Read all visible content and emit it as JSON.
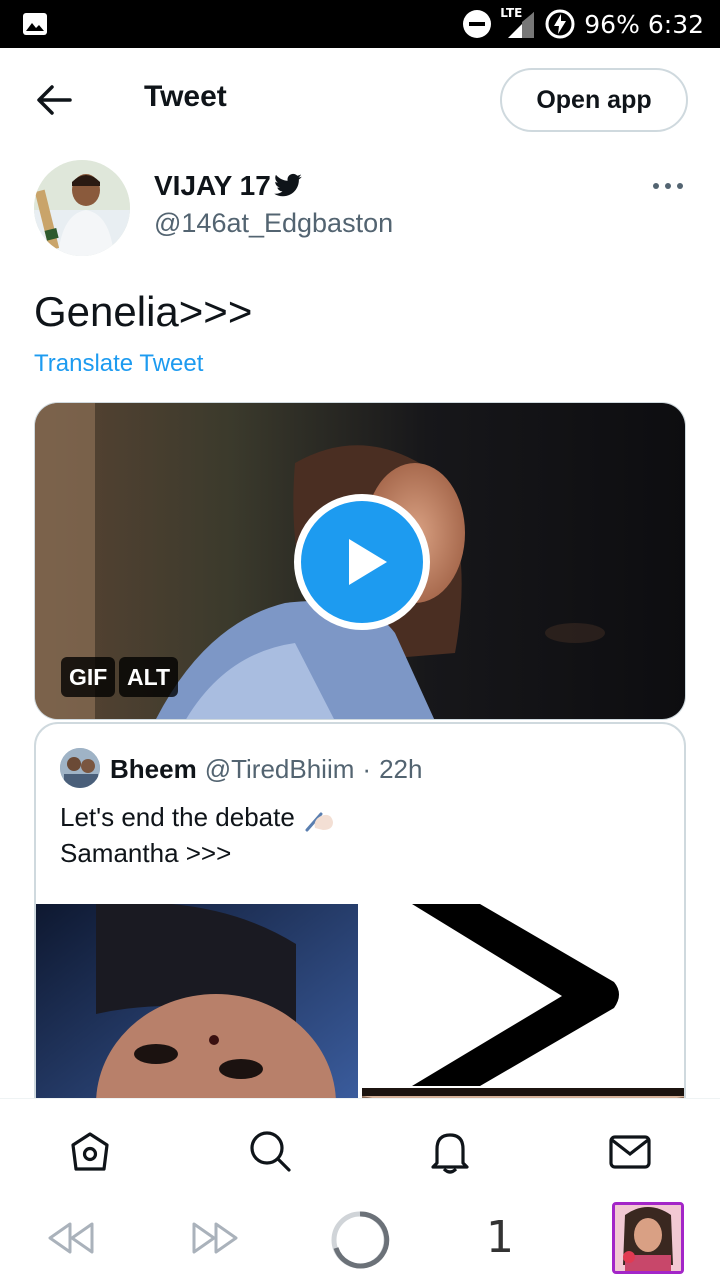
{
  "status_bar": {
    "network": "LTE",
    "battery": "96%",
    "time": "6:32"
  },
  "header": {
    "title": "Tweet",
    "open_app_label": "Open app"
  },
  "tweet": {
    "author_name": "VIJAY 17",
    "author_handle": "@146at_Edgbaston",
    "text": "Genelia>>>",
    "translate_label": "Translate Tweet",
    "media": {
      "gif_badge": "GIF",
      "alt_badge": "ALT"
    }
  },
  "quoted_tweet": {
    "name": "Bheem",
    "handle": "@TiredBhiim",
    "separator": "·",
    "time": "22h",
    "line1": "Let's end the debate",
    "line2": "Samantha >>>"
  },
  "bottom_nav": {
    "items": [
      "home-icon",
      "search-icon",
      "notifications-icon",
      "messages-icon"
    ]
  },
  "browser_bar": {
    "tab_count": "1"
  },
  "colors": {
    "accent": "#1d9bf0",
    "text_primary": "#0f1419",
    "text_secondary": "#536471",
    "border": "#cfd9de"
  }
}
